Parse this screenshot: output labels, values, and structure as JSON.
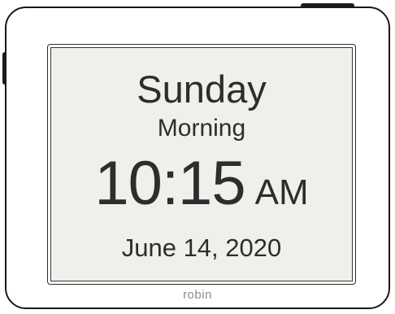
{
  "display": {
    "day": "Sunday",
    "period": "Morning",
    "time": "10:15",
    "am_pm": "AM",
    "date": "June 14, 2020"
  },
  "brand": {
    "name": "robin"
  },
  "colors": {
    "screen_background": "#efefec",
    "text": "#2d2d2d",
    "frame": "#ffffff",
    "outline": "#1a1a1a",
    "brand_text": "#8c8c8c"
  }
}
